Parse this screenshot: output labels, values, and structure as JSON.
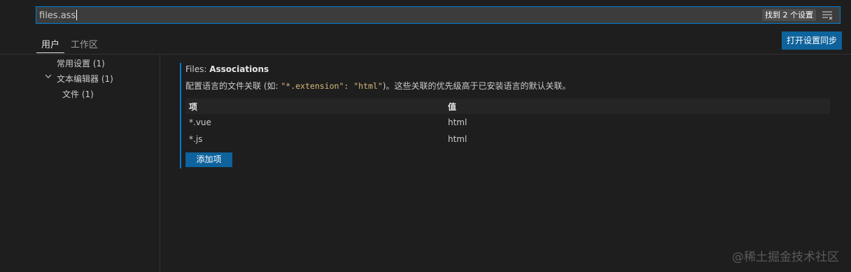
{
  "search": {
    "value": "files.ass",
    "result_count": "找到 2 个设置"
  },
  "tabs": [
    {
      "label": "用户"
    },
    {
      "label": "工作区"
    }
  ],
  "sync_button": "打开设置同步",
  "toc": [
    {
      "label": "常用设置 (1)"
    },
    {
      "label": "文本编辑器 (1)"
    },
    {
      "label": "文件 (1)"
    }
  ],
  "setting": {
    "category": "Files: ",
    "name": "Associations",
    "desc_prefix": "配置语言的文件关联 (如: ",
    "desc_code": "\"*.extension\": \"html\"",
    "desc_suffix": ")。这些关联的优先级高于已安装语言的默认关联。",
    "columns": {
      "item": "项",
      "value": "值"
    },
    "rows": [
      {
        "item": "*.vue",
        "value": "html"
      },
      {
        "item": "*.js",
        "value": "html"
      }
    ],
    "add_button": "添加项"
  },
  "watermark": "@稀土掘金技术社区",
  "colors": {
    "accent": "#007acc",
    "button": "#0e639c",
    "background": "#1e1e1e"
  }
}
